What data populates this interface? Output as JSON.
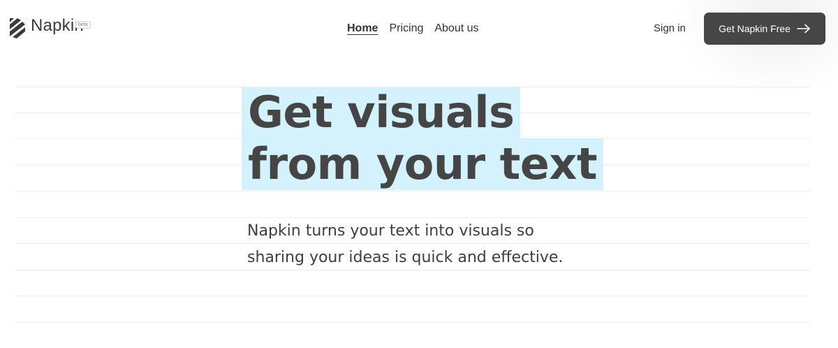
{
  "brand": {
    "name": "Napkin",
    "badge": "beta",
    "logo_icon": "napkin-stripes-icon"
  },
  "nav": {
    "items": [
      {
        "label": "Home",
        "active": true
      },
      {
        "label": "Pricing",
        "active": false
      },
      {
        "label": "About us",
        "active": false
      }
    ]
  },
  "auth": {
    "sign_in_label": "Sign in"
  },
  "cta": {
    "label": "Get Napkin Free",
    "icon": "arrow-right-icon",
    "background": "#464646",
    "text_color": "#ffffff"
  },
  "hero": {
    "title_lines": [
      "Get visuals",
      "from your text"
    ],
    "highlight_color": "#d3f2fd",
    "subtitle_lines": [
      "Napkin turns your text into visuals so",
      "sharing your ideas is quick and effective."
    ]
  }
}
